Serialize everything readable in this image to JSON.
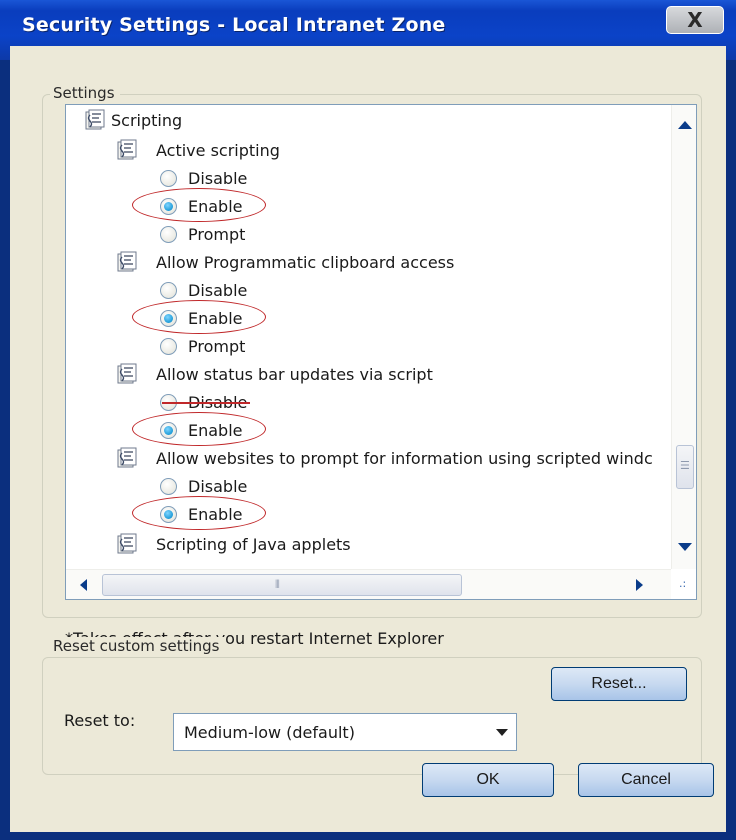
{
  "window": {
    "title": "Security Settings - Local Intranet Zone",
    "close_label": "X"
  },
  "settings_group": {
    "label": "Settings"
  },
  "tree": {
    "root": {
      "label": "Scripting",
      "icon": "script-settings-icon"
    },
    "settings": [
      {
        "label": "Active scripting",
        "icon": "script-settings-icon",
        "options": [
          {
            "label": "Disable",
            "selected": false
          },
          {
            "label": "Enable",
            "selected": true,
            "circled": true
          },
          {
            "label": "Prompt",
            "selected": false
          }
        ]
      },
      {
        "label": "Allow Programmatic clipboard access",
        "icon": "script-settings-icon",
        "options": [
          {
            "label": "Disable",
            "selected": false
          },
          {
            "label": "Enable",
            "selected": true,
            "circled": true
          },
          {
            "label": "Prompt",
            "selected": false
          }
        ]
      },
      {
        "label": "Allow status bar updates via script",
        "icon": "script-settings-icon",
        "options": [
          {
            "label": "Disable",
            "selected": false,
            "struck": true
          },
          {
            "label": "Enable",
            "selected": true,
            "circled": true
          }
        ]
      },
      {
        "label": "Allow websites to prompt for information using scripted windc",
        "icon": "script-settings-icon",
        "options": [
          {
            "label": "Disable",
            "selected": false
          },
          {
            "label": "Enable",
            "selected": true,
            "circled": true
          }
        ]
      },
      {
        "label": "Scripting of Java applets",
        "icon": "script-settings-icon"
      }
    ]
  },
  "note": "*Takes effect after you restart Internet Explorer",
  "reset_group": {
    "label": "Reset custom settings",
    "reset_to_label": "Reset to:",
    "selected_level": "Medium-low (default)",
    "reset_button": "Reset..."
  },
  "footer": {
    "ok_label": "OK",
    "cancel_label": "Cancel"
  },
  "colors": {
    "title_bar": "#0b43c8",
    "dialog_bg": "#ece9d8",
    "annotation": "#c0282a",
    "radio_selected": "#1f9cd8"
  }
}
